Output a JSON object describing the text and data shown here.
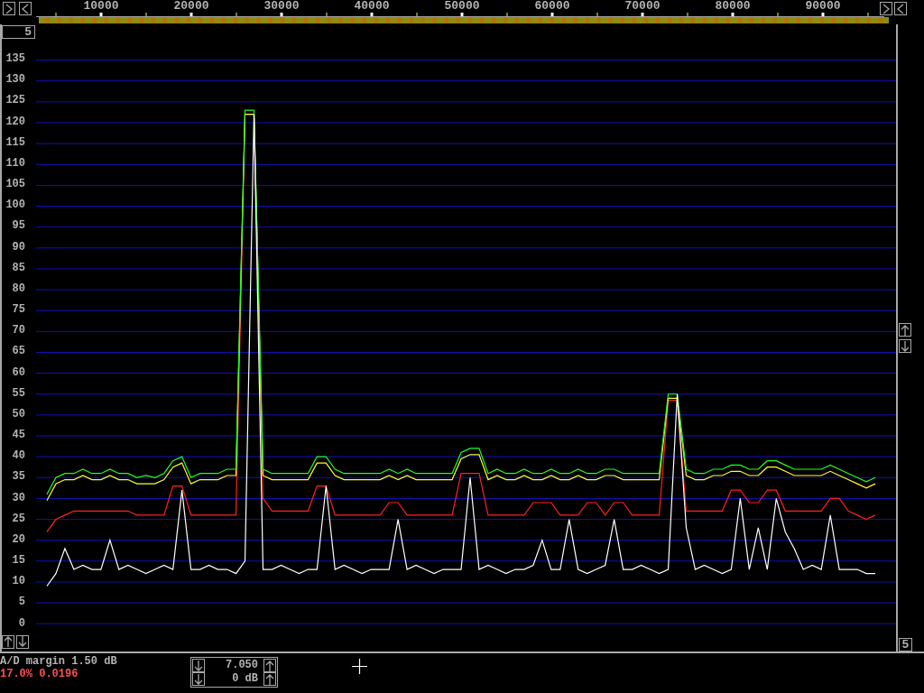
{
  "top_left_box": {
    "value": "5"
  },
  "chart_data": {
    "type": "line",
    "grid": true,
    "x": [
      4000,
      5000,
      6000,
      7000,
      8000,
      9000,
      10000,
      11000,
      12000,
      13000,
      14000,
      15000,
      16000,
      17000,
      18000,
      19000,
      20000,
      21000,
      22000,
      23000,
      24000,
      25000,
      26000,
      27000,
      28000,
      29000,
      30000,
      31000,
      32000,
      33000,
      34000,
      35000,
      36000,
      37000,
      38000,
      39000,
      40000,
      41000,
      42000,
      43000,
      44000,
      45000,
      46000,
      47000,
      48000,
      49000,
      50000,
      51000,
      52000,
      53000,
      54000,
      55000,
      56000,
      57000,
      58000,
      59000,
      60000,
      61000,
      62000,
      63000,
      64000,
      65000,
      66000,
      67000,
      68000,
      69000,
      70000,
      71000,
      72000,
      73000,
      74000,
      75000,
      76000,
      77000,
      78000,
      79000,
      80000,
      81000,
      82000,
      83000,
      84000,
      85000,
      86000,
      87000,
      88000,
      89000,
      90000,
      91000,
      92000,
      93000,
      94000,
      95000,
      96000
    ],
    "series": [
      {
        "color": "#ff2020",
        "values": [
          22,
          25,
          26,
          27,
          27,
          27,
          27,
          27,
          27,
          27,
          26,
          26,
          26,
          26,
          33,
          33,
          26,
          26,
          26,
          26,
          26,
          26,
          122,
          122,
          30,
          27,
          27,
          27,
          27,
          27,
          33,
          33,
          26,
          26,
          26,
          26,
          26,
          26,
          29,
          29,
          26,
          26,
          26,
          26,
          26,
          26,
          36,
          36,
          36,
          26,
          26,
          26,
          26,
          26,
          29,
          29,
          29,
          26,
          26,
          26,
          29,
          29,
          26,
          29,
          29,
          26,
          26,
          26,
          26,
          53.5,
          53.5,
          27,
          27,
          27,
          27,
          27,
          32,
          32,
          29,
          29,
          32,
          32,
          27,
          27,
          27,
          27,
          27,
          30,
          30,
          27,
          26,
          25,
          26
        ]
      },
      {
        "color": "#ffff30",
        "values": [
          29.5,
          33.5,
          34.5,
          34.5,
          35.5,
          34.5,
          34.5,
          35.5,
          34.5,
          34.5,
          33.5,
          33.5,
          33.5,
          34.5,
          37.5,
          38.5,
          33.5,
          34.5,
          34.5,
          34.5,
          35.5,
          35.5,
          122,
          122,
          35.5,
          34.5,
          34.5,
          34.5,
          34.5,
          34.5,
          38.5,
          38.5,
          35.5,
          34.5,
          34.5,
          34.5,
          34.5,
          34.5,
          35.5,
          34.5,
          35.5,
          34.5,
          34.5,
          34.5,
          34.5,
          34.5,
          39.5,
          40.5,
          40.5,
          34.5,
          35.5,
          34.5,
          34.5,
          35.5,
          34.5,
          34.5,
          35.5,
          34.5,
          34.5,
          35.5,
          34.5,
          34.5,
          35.5,
          35.5,
          34.5,
          34.5,
          34.5,
          34.5,
          34.5,
          54,
          54,
          35.5,
          34.5,
          34.5,
          35.5,
          35.5,
          36.5,
          36.5,
          35.5,
          35.5,
          37.5,
          37.5,
          36.5,
          35.5,
          35.5,
          35.5,
          35.5,
          36.5,
          35.5,
          34.5,
          33.5,
          32.5,
          33.5
        ]
      },
      {
        "color": "#20ff20",
        "values": [
          31,
          35,
          36,
          36,
          37,
          36,
          36,
          37,
          36,
          36,
          35,
          35.5,
          35,
          36,
          39,
          40,
          35,
          36,
          36,
          36,
          37,
          37,
          123,
          123,
          37,
          36,
          36,
          36,
          36,
          36,
          40,
          40,
          37,
          36,
          36,
          36,
          36,
          36,
          37,
          36,
          37,
          36,
          36,
          36,
          36,
          36,
          41,
          42,
          42,
          36,
          37,
          36,
          36,
          37,
          36,
          36,
          37,
          36,
          36,
          37,
          36,
          36,
          37,
          37,
          36,
          36,
          36,
          36,
          36,
          55,
          55,
          37,
          36,
          36,
          37,
          37,
          38,
          38,
          37,
          37,
          39,
          39,
          38,
          37,
          37,
          37,
          37,
          38,
          37,
          36,
          35,
          34,
          35
        ]
      },
      {
        "color": "#ffffff",
        "values": [
          9,
          12,
          18,
          13,
          14,
          13,
          13,
          20,
          13,
          14,
          13,
          12,
          13,
          14,
          13,
          32,
          13,
          13,
          14,
          13,
          13,
          12,
          15,
          122,
          13,
          13,
          14,
          13,
          12,
          13,
          13,
          33,
          13,
          14,
          13,
          12,
          13,
          13,
          13,
          25,
          13,
          14,
          13,
          12,
          13,
          13,
          13,
          35,
          13,
          14,
          13,
          12,
          13,
          13,
          14,
          20,
          13,
          13,
          25,
          13,
          12,
          13,
          14,
          25,
          13,
          13,
          14,
          13,
          12,
          13,
          55,
          23,
          13,
          14,
          13,
          12,
          13,
          30,
          13,
          23,
          13,
          30,
          22,
          18,
          13,
          14,
          13,
          26,
          13,
          13,
          13,
          12,
          12
        ]
      }
    ],
    "xlim": [
      2800,
      98300
    ],
    "ylim": [
      -6.5,
      143.4
    ],
    "xticks": [
      {
        "value": 10000,
        "label": "10000"
      },
      {
        "value": 20000,
        "label": "20000"
      },
      {
        "value": 30000,
        "label": "30000"
      },
      {
        "value": 40000,
        "label": "40000"
      },
      {
        "value": 50000,
        "label": "50000"
      },
      {
        "value": 60000,
        "label": "60000"
      },
      {
        "value": 70000,
        "label": "70000"
      },
      {
        "value": 80000,
        "label": "80000"
      },
      {
        "value": 90000,
        "label": "90000"
      }
    ],
    "yticks": [
      0,
      5,
      10,
      15,
      20,
      25,
      30,
      35,
      40,
      45,
      50,
      55,
      60,
      65,
      70,
      75,
      80,
      85,
      90,
      95,
      100,
      105,
      110,
      115,
      120,
      125,
      130,
      135
    ]
  },
  "bottom_right_box": {
    "value": "5"
  },
  "status": {
    "ad_margin": "A/D margin 1.50 dB",
    "readout": "17.0% 0.0196"
  },
  "control_box": {
    "rows": [
      {
        "value": "7.050"
      },
      {
        "value": "0 dB"
      }
    ]
  }
}
